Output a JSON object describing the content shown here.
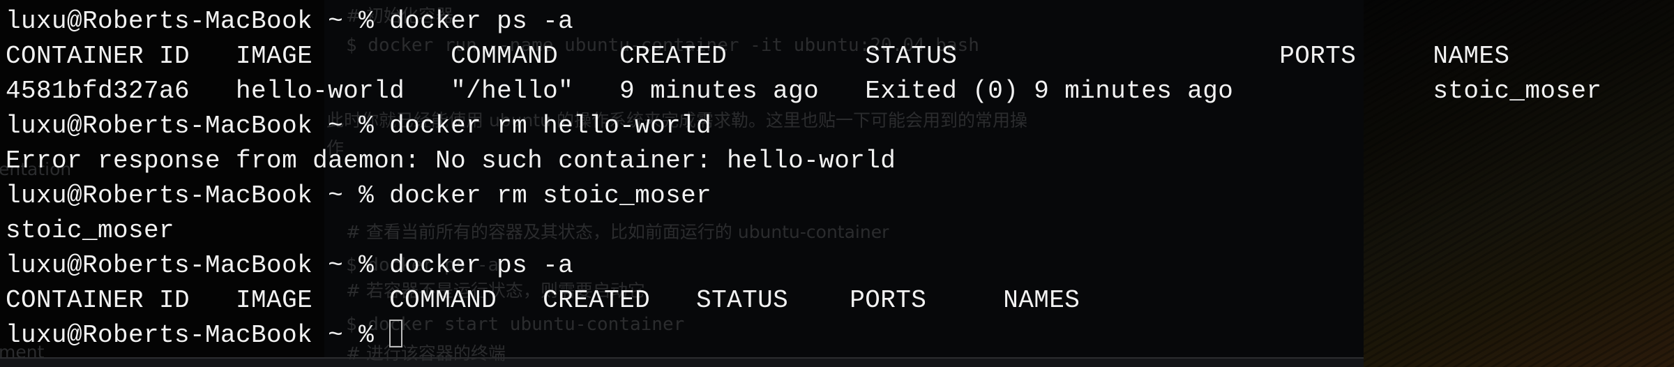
{
  "terminal": {
    "lines": [
      "luxu@Roberts-MacBook ~ % docker ps -a",
      "CONTAINER ID   IMAGE         COMMAND    CREATED         STATUS                     PORTS     NAMES",
      "4581bfd327a6   hello-world   \"/hello\"   9 minutes ago   Exited (0) 9 minutes ago             stoic_moser",
      "luxu@Roberts-MacBook ~ % docker rm hello-world",
      "Error response from daemon: No such container: hello-world",
      "luxu@Roberts-MacBook ~ % docker rm stoic_moser",
      "stoic_moser",
      "luxu@Roberts-MacBook ~ % docker ps -a",
      "CONTAINER ID   IMAGE     COMMAND   CREATED   STATUS    PORTS     NAMES",
      "luxu@Roberts-MacBook ~ % "
    ]
  },
  "background_document": {
    "lines": [
      "# 初始化容器",
      "$ docker run --name ubuntu-container -it ubuntu:20.04 bash",
      "此时你就已经能使用 ubuntu 的操作系统来完成需求勒。这里也贴一下可能会用到的常用操",
      "作",
      "# 查看当前所有的容器及其状态，比如前面运行的 ubuntu-container",
      "$ docker ps -a",
      "# 若容器不是运行状态，则需要启动它",
      "$ docker start ubuntu-container",
      "# 进行该容器的终端"
    ],
    "sidebar_fragments": [
      "entation",
      "ment"
    ]
  }
}
